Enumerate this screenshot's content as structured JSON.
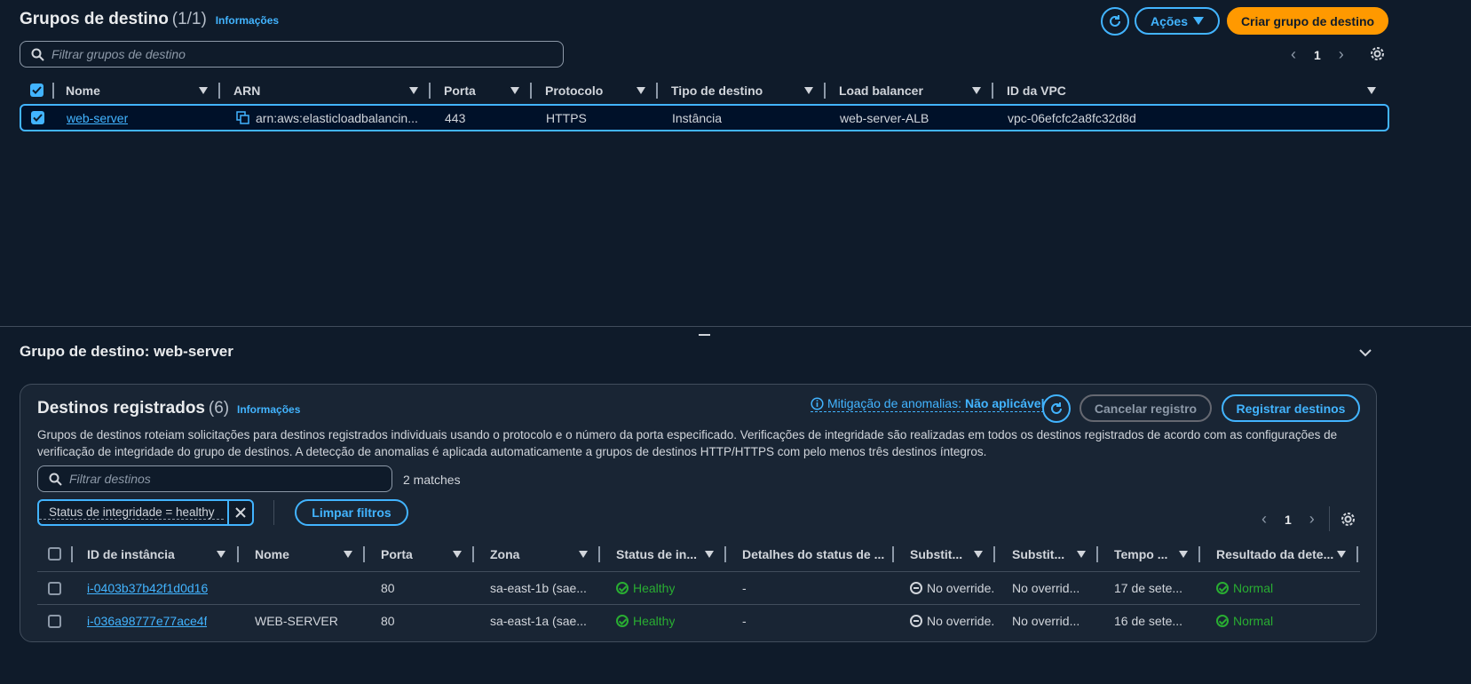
{
  "top": {
    "title": "Grupos de destino",
    "count": "(1/1)",
    "info": "Informações",
    "actions_label": "Ações",
    "create_label": "Criar grupo de destino",
    "filter_placeholder": "Filtrar grupos de destino",
    "page": "1",
    "columns": [
      "Nome",
      "ARN",
      "Porta",
      "Protocolo",
      "Tipo de destino",
      "Load balancer",
      "ID da VPC"
    ],
    "row": {
      "name": "web-server",
      "arn": "arn:aws:elasticloadbalancin...",
      "port": "443",
      "protocol": "HTTPS",
      "target_type": "Instância",
      "load_balancer": "web-server-ALB",
      "vpc": "vpc-06efcfc2a8fc32d8d"
    }
  },
  "detail": {
    "title": "Grupo de destino: web-server"
  },
  "targets": {
    "title": "Destinos registrados",
    "count": "(6)",
    "info": "Informações",
    "anomaly_label": "Mitigação de anomalias:",
    "anomaly_value": "Não aplicável",
    "deregister_label": "Cancelar registro",
    "register_label": "Registrar destinos",
    "description_line1": "Grupos de destinos roteiam solicitações para destinos registrados individuais usando o protocolo e o número da porta especificado. Verificações de integridade são realizadas em todos os destinos registrados de acordo com as configurações de",
    "description_line2": "verificação de integridade do grupo de destinos. A detecção de anomalias é aplicada automaticamente a grupos de destinos HTTP/HTTPS com pelo menos três destinos íntegros.",
    "filter_placeholder": "Filtrar destinos",
    "matches": "2 matches",
    "token": "Status de integridade = healthy",
    "clear_label": "Limpar filtros",
    "page": "1",
    "columns": [
      "ID de instância",
      "Nome",
      "Porta",
      "Zona",
      "Status de in...",
      "Detalhes do status de ...",
      "Substit...",
      "Substit...",
      "Tempo ...",
      "Resultado da dete..."
    ],
    "rows": [
      {
        "id": "i-0403b37b42f1d0d16",
        "name": "",
        "port": "80",
        "zone": "sa-east-1b (sae...",
        "status": "Healthy",
        "details": "-",
        "override1": "No override.",
        "override2": "No overrid...",
        "time": "17 de sete...",
        "result": "Normal"
      },
      {
        "id": "i-036a98777e77ace4f",
        "name": "WEB-SERVER",
        "port": "80",
        "zone": "sa-east-1a (sae...",
        "status": "Healthy",
        "details": "-",
        "override1": "No override.",
        "override2": "No overrid...",
        "time": "16 de sete...",
        "result": "Normal"
      }
    ]
  },
  "colors": {
    "accent": "#42b4ff",
    "primary": "#ff9900",
    "success": "#29ad32",
    "background": "#0f1b2a"
  }
}
